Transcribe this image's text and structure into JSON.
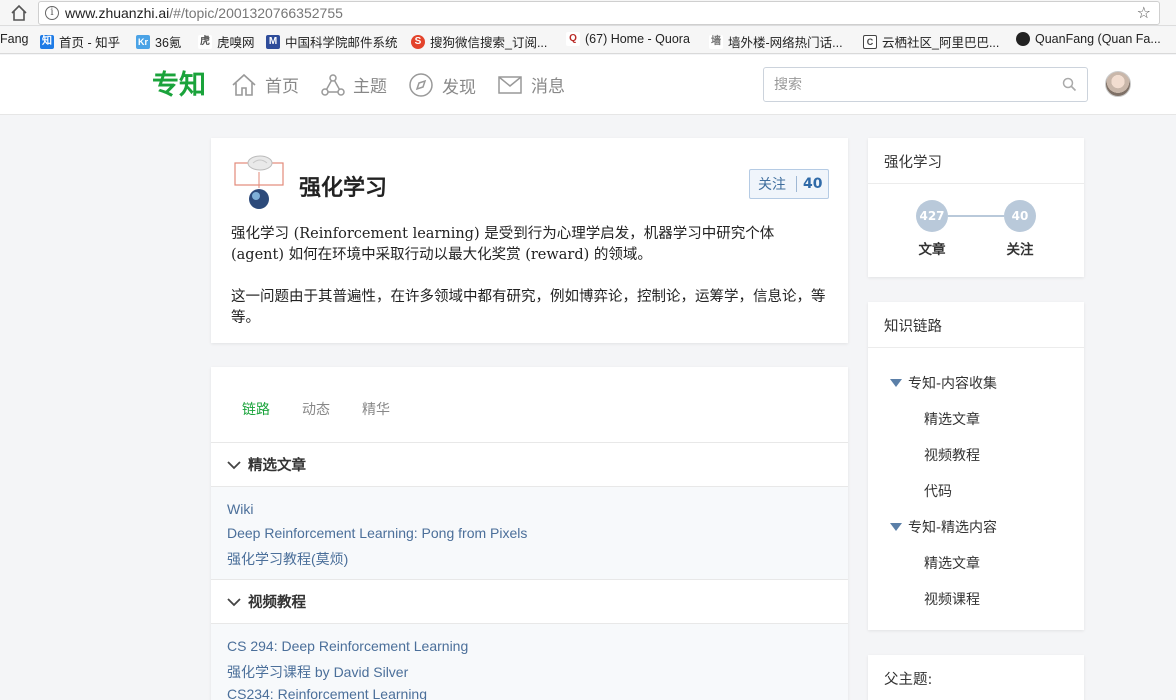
{
  "browser": {
    "url_host": "www.zhuanzhi.ai",
    "url_path": "/#/topic/2001320766352755",
    "bookmarks": [
      {
        "label": "Fang",
        "icon": "none"
      },
      {
        "label": "首页 - 知乎",
        "icon": "zhihu-icon",
        "color": "#1e7be6",
        "glyph": "知"
      },
      {
        "label": "36氪",
        "icon": "36kr-icon",
        "color": "#4ba3e6",
        "glyph": "Kr"
      },
      {
        "label": "虎嗅网",
        "icon": "huxiu-icon",
        "color": "#555555",
        "glyph": "虎"
      },
      {
        "label": "中国科学院邮件系统",
        "icon": "mail-icon",
        "color": "#2e4c9a",
        "glyph": "M"
      },
      {
        "label": "搜狗微信搜索_订阅...",
        "icon": "sogou-icon",
        "color": "#e3432b",
        "glyph": "S"
      },
      {
        "label": "(67) Home - Quora",
        "icon": "quora-icon",
        "color": "#b92b27",
        "glyph": "Q"
      },
      {
        "label": "墙外楼-网络热门话...",
        "icon": "wall-icon",
        "color": "#777777",
        "glyph": "墙"
      },
      {
        "label": "云栖社区_阿里巴巴...",
        "icon": "aliyun-icon",
        "color": "#444444",
        "glyph": "C"
      },
      {
        "label": "QuanFang (Quan Fa...",
        "icon": "github-icon",
        "color": "#222222",
        "glyph": "●"
      }
    ]
  },
  "header": {
    "logo": "专知",
    "nav": [
      {
        "label": "首页",
        "icon": "home-icon"
      },
      {
        "label": "主题",
        "icon": "topic-icon"
      },
      {
        "label": "发现",
        "icon": "compass-icon"
      },
      {
        "label": "消息",
        "icon": "envelope-icon"
      }
    ],
    "search_placeholder": "搜索"
  },
  "topic": {
    "title": "强化学习",
    "follow_label": "关注",
    "follow_count": "40",
    "desc_1": "强化学习 (Reinforcement learning) 是受到行为心理学启发，机器学习中研究个体 (agent) 如何在环境中采取行动以最大化奖赏 (reward) 的领域。",
    "desc_2": "这一问题由于其普遍性，在许多领域中都有研究，例如博弈论，控制论，运筹学，信息论，等等。"
  },
  "tabs": [
    "链路",
    "动态",
    "精华"
  ],
  "sections": [
    {
      "title": "精选文章",
      "links": [
        "Wiki",
        "Deep Reinforcement Learning: Pong from Pixels",
        "强化学习教程(莫烦)"
      ]
    },
    {
      "title": "视频教程",
      "links": [
        "CS 294: Deep Reinforcement Learning",
        "强化学习课程 by David Silver",
        "CS234: Reinforcement Learning"
      ]
    }
  ],
  "stats": {
    "title": "强化学习",
    "articles_count": "427",
    "articles_label": "文章",
    "followers_count": "40",
    "followers_label": "关注"
  },
  "chain": {
    "title": "知识链路",
    "groups": [
      {
        "label": "专知-内容收集",
        "children": [
          "精选文章",
          "视频教程",
          "代码"
        ]
      },
      {
        "label": "专知-精选内容",
        "children": [
          "精选文章",
          "视频课程"
        ]
      }
    ]
  },
  "parent": {
    "title": "父主题:"
  },
  "colors": {
    "brand": "#1aa33b",
    "link": "#4b6f9a",
    "follow_bg": "#f0f5fb"
  }
}
